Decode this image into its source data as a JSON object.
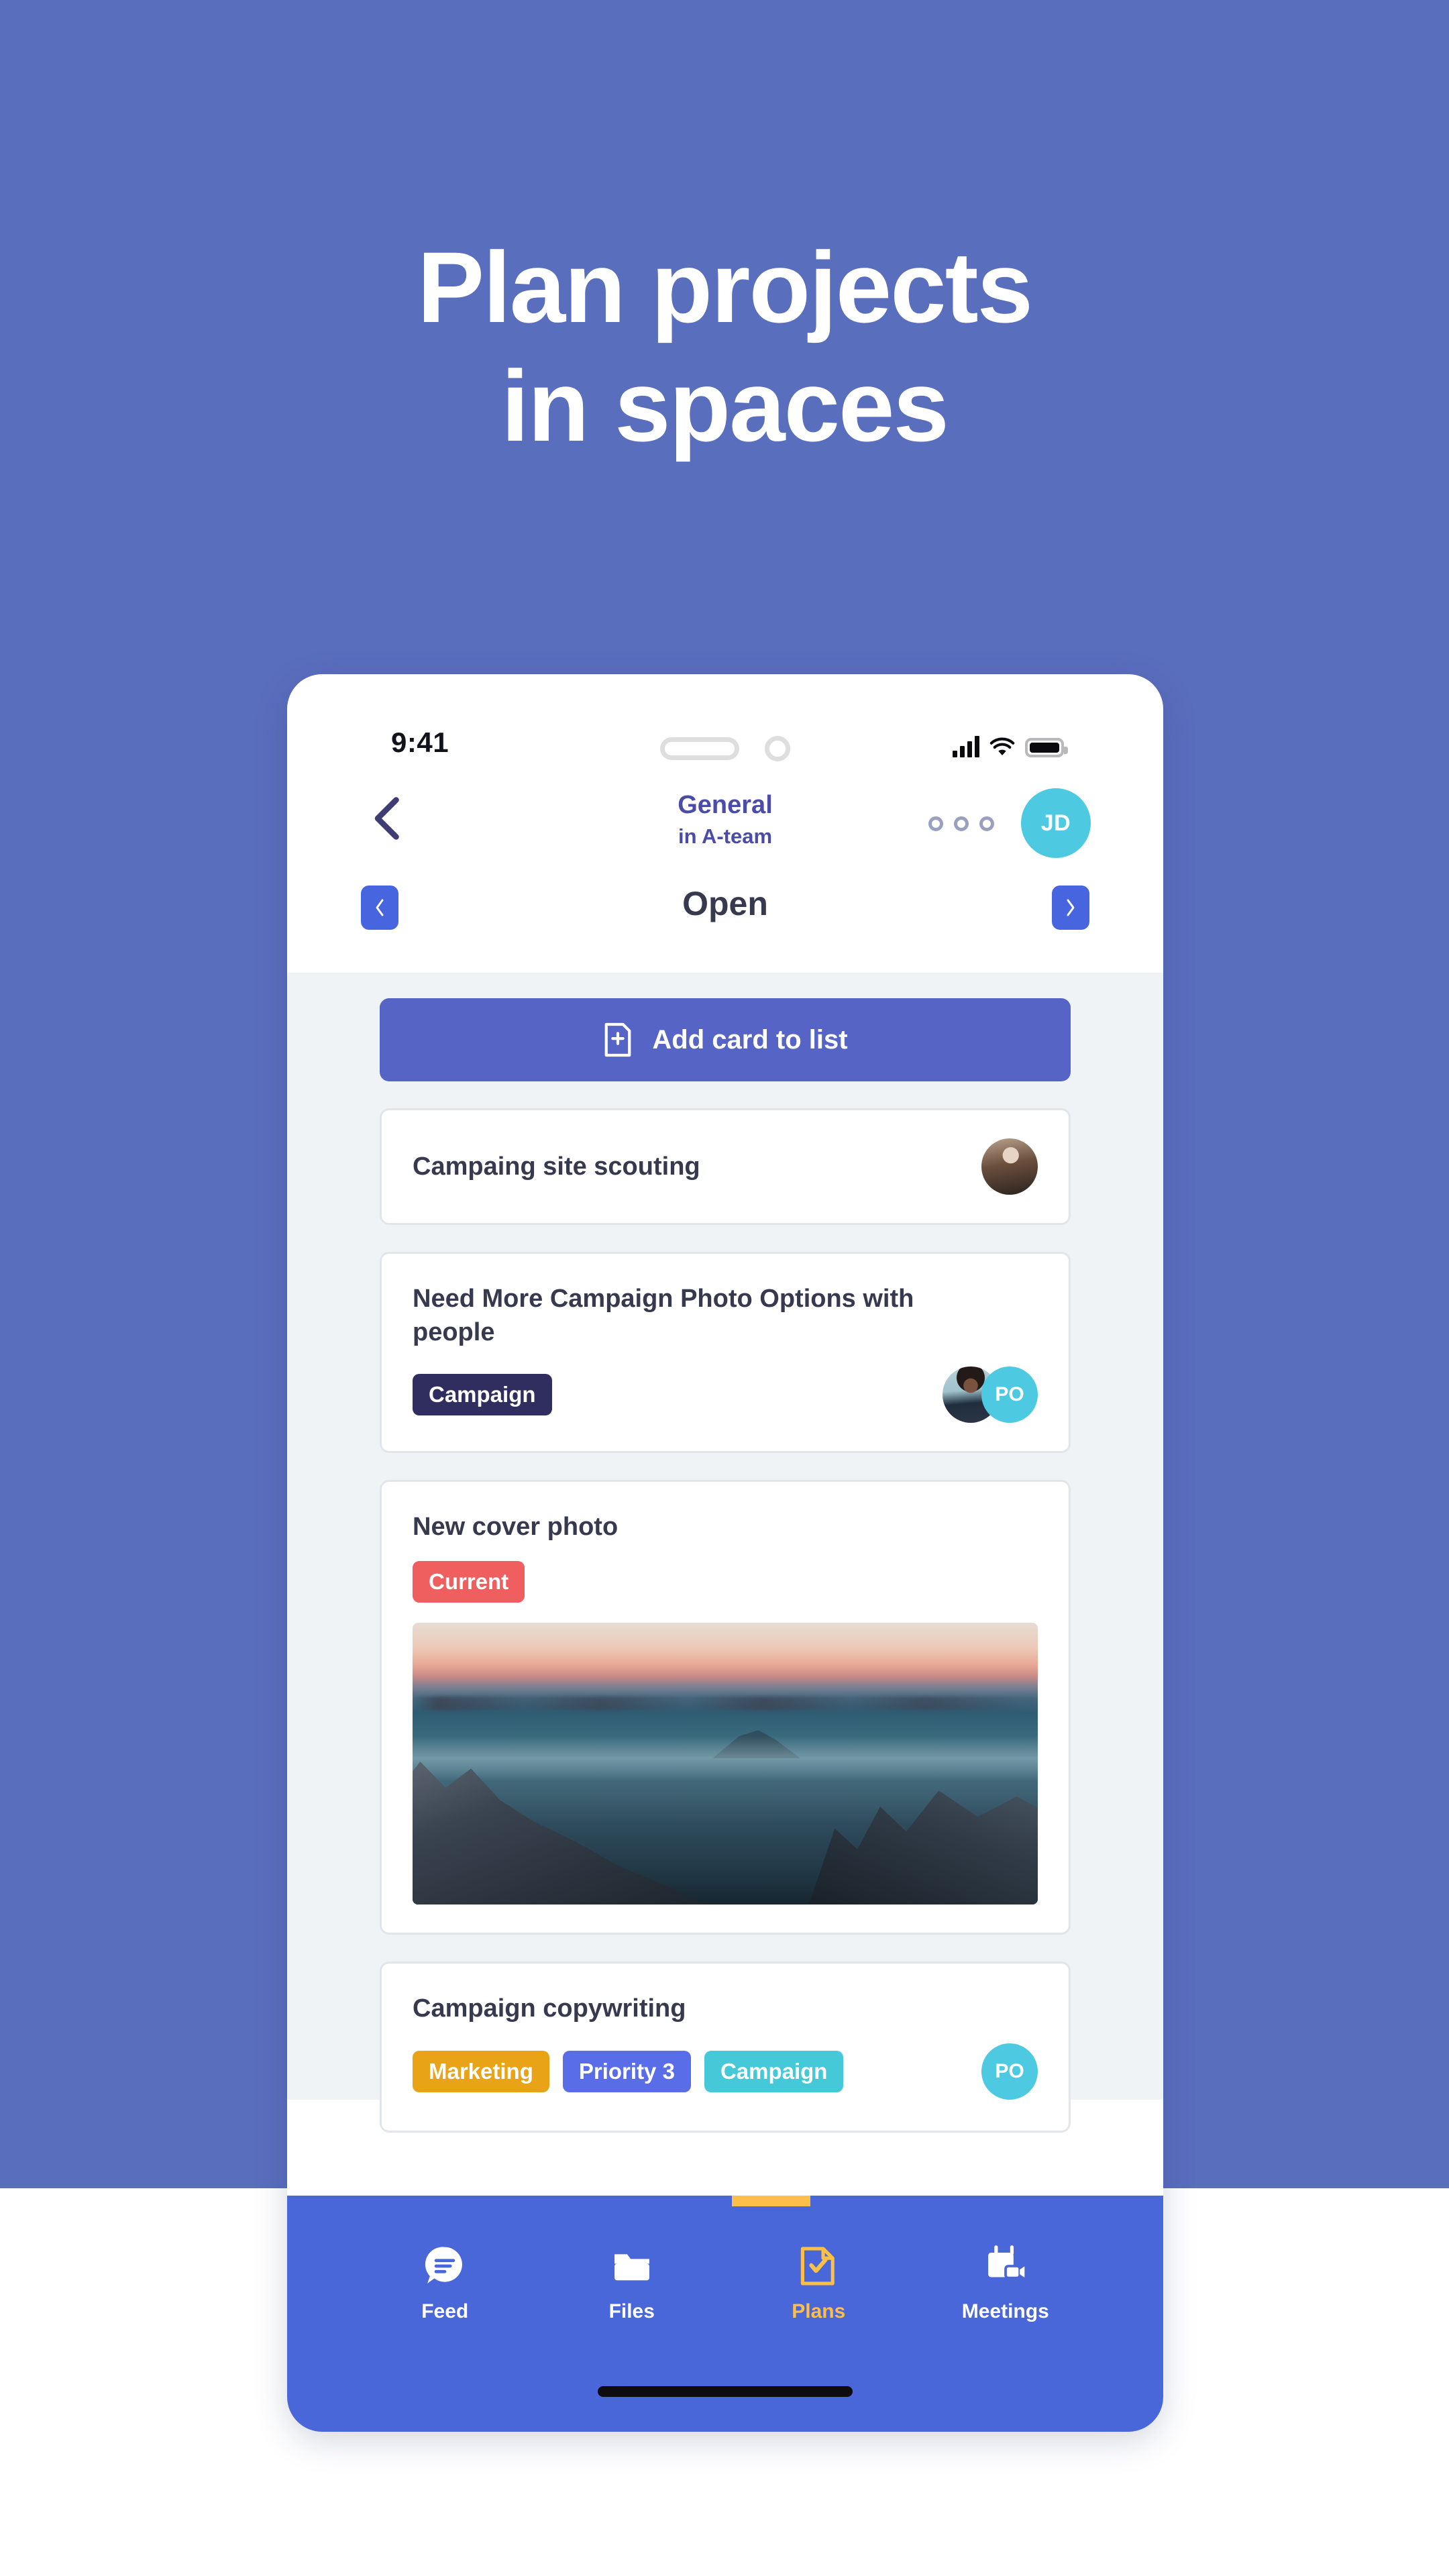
{
  "hero": {
    "headline_line1": "Plan projects",
    "headline_line2": "in spaces",
    "background_color": "#5A6EBE",
    "text_color": "#FFFFFF"
  },
  "status_bar": {
    "time": "9:41",
    "signal_icon": "signal-bars-icon",
    "wifi_icon": "wifi-icon",
    "battery_icon": "battery-full-icon",
    "speaker_icon": "earpiece-speaker-icon",
    "camera_icon": "front-camera-icon"
  },
  "app_header": {
    "back_icon": "chevron-left-icon",
    "title": "General",
    "subtitle": "in A-team",
    "more_icon": "more-options-icon",
    "avatar_initials": "JD",
    "avatar_color": "#4DCAE2",
    "title_color": "#4B4BA8"
  },
  "list_nav": {
    "prev_icon": "chevron-left-icon",
    "next_icon": "chevron-right-icon",
    "list_name": "Open",
    "button_color": "#4665DE"
  },
  "board": {
    "add_card_label": "Add card to list",
    "add_card_icon": "add-card-icon",
    "add_card_color": "#5664C6",
    "cards": [
      {
        "title": "Campaing site scouting",
        "tags": [],
        "avatars": [
          {
            "type": "photo",
            "name": "member-photo-avatar"
          }
        ],
        "has_cover_photo": false
      },
      {
        "title": "Need More Campaign Photo Options with people",
        "tags": [
          {
            "label": "Campaign",
            "color": "#2F2E5E"
          }
        ],
        "avatars": [
          {
            "type": "photo",
            "name": "member-photo-avatar"
          },
          {
            "type": "initials",
            "initials": "PO",
            "color": "#4DCAE2"
          }
        ],
        "has_cover_photo": false
      },
      {
        "title": "New cover photo",
        "tags": [
          {
            "label": "Current",
            "color": "#EF5F5F"
          }
        ],
        "avatars": [],
        "has_cover_photo": true,
        "cover_photo_alt": "mountain sunset landscape"
      },
      {
        "title": "Campaign copywriting",
        "tags": [
          {
            "label": "Marketing",
            "color": "#E8A317"
          },
          {
            "label": "Priority 3",
            "color": "#5A6DE8"
          },
          {
            "label": "Campaign",
            "color": "#45C8D8"
          }
        ],
        "avatars": [
          {
            "type": "initials",
            "initials": "PO",
            "color": "#4DCAE2"
          }
        ],
        "has_cover_photo": false
      }
    ]
  },
  "bottom_nav": {
    "background_color": "#4A67DA",
    "active_color": "#FCBF49",
    "items": [
      {
        "label": "Feed",
        "icon": "feed-chat-bubble-icon",
        "active": false
      },
      {
        "label": "Files",
        "icon": "folder-icon",
        "active": false
      },
      {
        "label": "Plans",
        "icon": "plans-checklist-icon",
        "active": true
      },
      {
        "label": "Meetings",
        "icon": "meetings-calendar-video-icon",
        "active": false
      }
    ]
  }
}
